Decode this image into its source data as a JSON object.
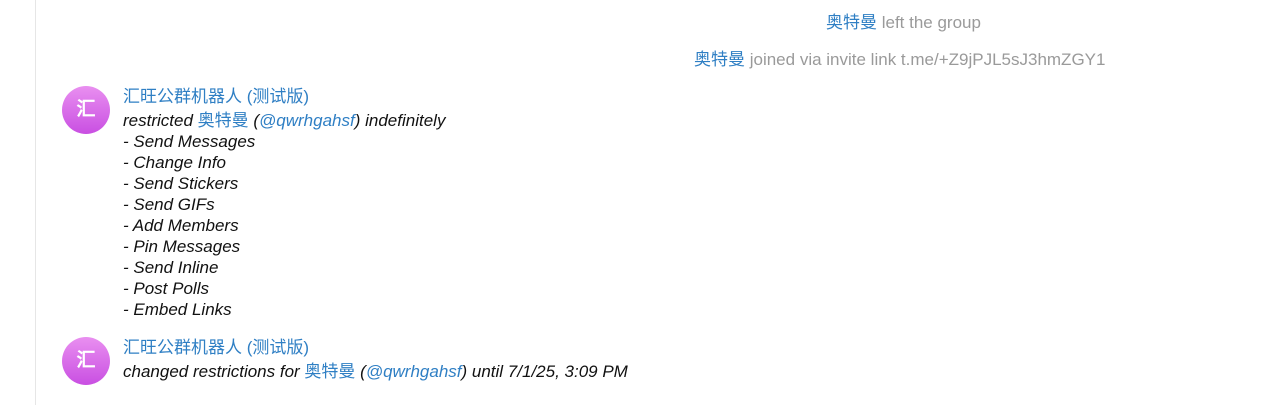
{
  "service_messages": {
    "left": {
      "name": "奥特曼",
      "text": " left the group"
    },
    "joined": {
      "name": "奥特曼",
      "text": " joined via invite link t.me/+Z9jPJL5sJ3hmZGY1"
    }
  },
  "messages": [
    {
      "avatar_letter": "汇",
      "sender": "汇旺公群机器人 (测试版)",
      "action": "restricted ",
      "target_name": "奥特曼",
      "open_paren": " (",
      "handle": "@qwrhgahsf",
      "close_text": ") indefinitely",
      "items": [
        "- Send Messages",
        "- Change Info",
        "- Send Stickers",
        "- Send GIFs",
        "- Add Members",
        "- Pin Messages",
        "- Send Inline",
        "- Post Polls",
        "- Embed Links"
      ]
    },
    {
      "avatar_letter": "汇",
      "sender": "汇旺公群机器人 (测试版)",
      "action": "changed restrictions for ",
      "target_name": "奥特曼",
      "open_paren": " (",
      "handle": "@qwrhgahsf",
      "close_text": ") until 7/1/25, 3:09 PM"
    }
  ],
  "colors": {
    "link": "#2f7fc4",
    "service_text": "#9a9a9a",
    "avatar_gradient_top": "#e98ff0",
    "avatar_gradient_bottom": "#c94fe2"
  }
}
